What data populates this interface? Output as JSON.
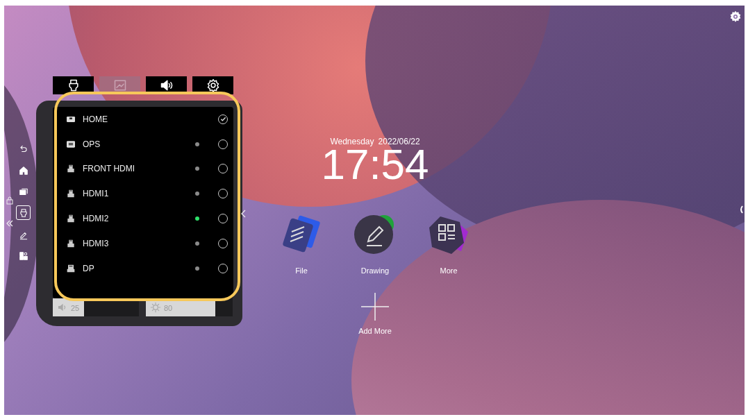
{
  "top_tabs": [
    {
      "kind": "source",
      "disabled": false
    },
    {
      "kind": "picture",
      "disabled": true
    },
    {
      "kind": "sound",
      "disabled": false
    },
    {
      "kind": "settings",
      "disabled": false
    }
  ],
  "sources": [
    {
      "name": "HOME",
      "kind": "home",
      "selected": true
    },
    {
      "name": "OPS",
      "kind": "ops",
      "color": "#8a8a8a",
      "selected": false
    },
    {
      "name": "FRONT HDMI",
      "kind": "hdmi",
      "color": "#8a8a8a",
      "selected": false
    },
    {
      "name": "HDMI1",
      "kind": "hdmi",
      "color": "#8a8a8a",
      "selected": false
    },
    {
      "name": "HDMI2",
      "kind": "hdmi",
      "color": "#2ee06a",
      "selected": false
    },
    {
      "name": "HDMI3",
      "kind": "hdmi",
      "color": "#8a8a8a",
      "selected": false
    },
    {
      "name": "DP",
      "kind": "dp",
      "color": "#8a8a8a",
      "selected": false
    }
  ],
  "volume": {
    "level": 0.36,
    "reading": "25"
  },
  "brightness": {
    "level": 0.8,
    "reading": "80"
  },
  "sidebar": [
    {
      "kind": "undo",
      "selected": false
    },
    {
      "kind": "home",
      "selected": false
    },
    {
      "kind": "windows",
      "selected": false
    },
    {
      "kind": "source",
      "selected": true
    },
    {
      "kind": "pen",
      "selected": false
    },
    {
      "kind": "apps",
      "selected": false
    }
  ],
  "clock": {
    "day": "Wednesday",
    "date": "2022/06/22",
    "time": "17:54"
  },
  "apps": [
    {
      "label": "File",
      "kind": "file"
    },
    {
      "label": "Drawing",
      "kind": "drawing"
    },
    {
      "label": "More",
      "kind": "more"
    }
  ],
  "add_more": {
    "label": "Add More"
  }
}
